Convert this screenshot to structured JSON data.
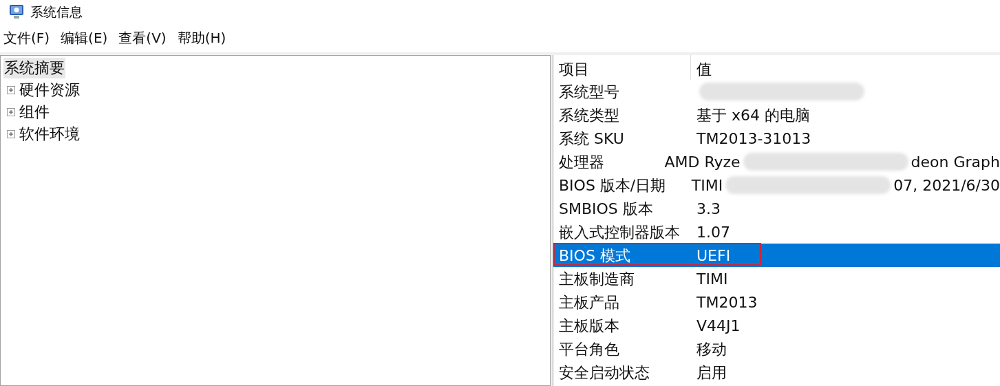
{
  "window": {
    "title": "系统信息"
  },
  "menu": [
    "文件(F)",
    "编辑(E)",
    "查看(V)",
    "帮助(H)"
  ],
  "tree": [
    {
      "label": "系统摘要",
      "selected": true
    },
    {
      "label": "硬件资源",
      "selected": false,
      "expanded": false
    },
    {
      "label": "组件",
      "selected": false,
      "expanded": false
    },
    {
      "label": "软件环境",
      "selected": false,
      "expanded": false
    }
  ],
  "table": {
    "columns": [
      "项目",
      "值"
    ],
    "rows": [
      {
        "item": "系统型号",
        "selected": false,
        "outlined": false,
        "value": [
          {
            "kind": "redaction"
          }
        ]
      },
      {
        "item": "系统类型",
        "selected": false,
        "outlined": false,
        "value": [
          {
            "kind": "text",
            "text": "基于 x64 的电脑"
          }
        ]
      },
      {
        "item": "系统 SKU",
        "selected": false,
        "outlined": false,
        "value": [
          {
            "kind": "text",
            "text": "TM2013-31013"
          }
        ]
      },
      {
        "item": "处理器",
        "selected": false,
        "outlined": false,
        "value": [
          {
            "kind": "text",
            "text": "AMD Ryze"
          },
          {
            "kind": "redaction"
          },
          {
            "kind": "text",
            "text": "deon Graph"
          }
        ]
      },
      {
        "item": "BIOS 版本/日期",
        "selected": false,
        "outlined": false,
        "value": [
          {
            "kind": "text",
            "text": "TIMI"
          },
          {
            "kind": "redaction"
          },
          {
            "kind": "text",
            "text": "07, 2021/6/30"
          }
        ]
      },
      {
        "item": "SMBIOS 版本",
        "selected": false,
        "outlined": false,
        "value": [
          {
            "kind": "text",
            "text": "3.3"
          }
        ]
      },
      {
        "item": "嵌入式控制器版本",
        "selected": false,
        "outlined": false,
        "value": [
          {
            "kind": "text",
            "text": "1.07"
          }
        ]
      },
      {
        "item": "BIOS 模式",
        "selected": true,
        "outlined": true,
        "value": [
          {
            "kind": "text",
            "text": "UEFI"
          }
        ]
      },
      {
        "item": "主板制造商",
        "selected": false,
        "outlined": false,
        "value": [
          {
            "kind": "text",
            "text": "TIMI"
          }
        ]
      },
      {
        "item": "主板产品",
        "selected": false,
        "outlined": false,
        "value": [
          {
            "kind": "text",
            "text": "TM2013"
          }
        ]
      },
      {
        "item": "主板版本",
        "selected": false,
        "outlined": false,
        "value": [
          {
            "kind": "text",
            "text": "V44J1"
          }
        ]
      },
      {
        "item": "平台角色",
        "selected": false,
        "outlined": false,
        "value": [
          {
            "kind": "text",
            "text": "移动"
          }
        ]
      },
      {
        "item": "安全启动状态",
        "selected": false,
        "outlined": false,
        "value": [
          {
            "kind": "text",
            "text": "启用"
          }
        ]
      }
    ]
  }
}
